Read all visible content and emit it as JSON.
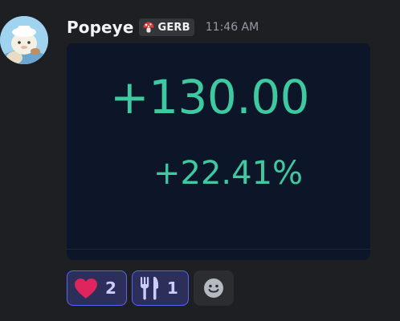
{
  "message": {
    "author": "Popeye",
    "guild_tag": "GERB",
    "timestamp": "11:46 AM"
  },
  "embed": {
    "pnl_value": "+130.00",
    "pnl_percent": "+22.41%"
  },
  "reactions": [
    {
      "icon": "heart-icon",
      "count": "2"
    },
    {
      "icon": "fork-knife-icon",
      "count": "1"
    }
  ],
  "icons": {
    "guild_tag": "mushroom-icon",
    "add_reaction": "smiley-icon"
  },
  "colors": {
    "accent": "#5865f2",
    "profit_green": "#3ec9a0",
    "heart_red": "#e0245e"
  }
}
